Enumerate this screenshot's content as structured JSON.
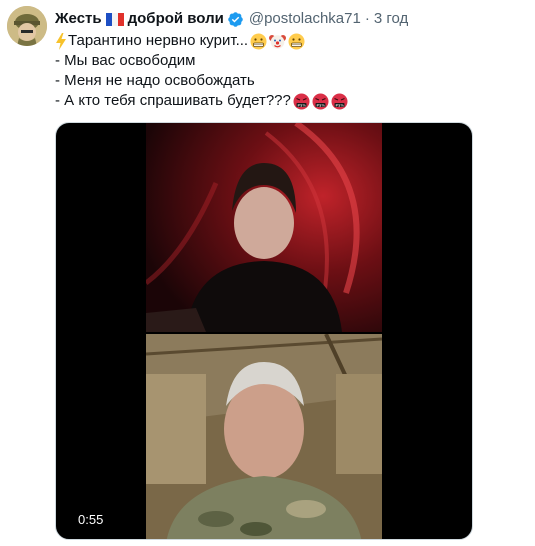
{
  "tweet": {
    "author_name_part1": "Жесть",
    "author_name_part2": "доброй воли",
    "handle": "@postolachka71",
    "separator": "·",
    "time": "3 год",
    "text_lines": [
      "Тарантино нервно курит...",
      "- Мы вас освободим",
      "- Меня не надо освобождать",
      "- А кто тебя спрашивать будет???"
    ],
    "icons": {
      "line1_prefix": "high-voltage-emoji",
      "line1_suffix": [
        "grimacing-face-emoji",
        "clown-face-emoji",
        "grimacing-face-emoji"
      ],
      "line4_suffix": [
        "symbols-on-mouth-emoji",
        "symbols-on-mouth-emoji",
        "symbols-on-mouth-emoji"
      ],
      "author_flag": "france-flag",
      "verified_badge": "verified-badge-icon"
    },
    "colors": {
      "text": "#0f1419",
      "secondary": "#536471",
      "verified": "#1d9bf0"
    },
    "media": {
      "type": "video",
      "duration": "0:55"
    }
  }
}
